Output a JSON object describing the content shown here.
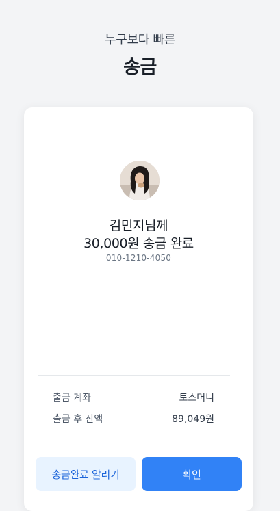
{
  "header": {
    "subtitle": "누구보다 빠른",
    "title": "송금"
  },
  "transfer": {
    "recipient": "김민지님께",
    "amount_message": "30,000원 송금 완료",
    "phone": "010-1210-4050"
  },
  "details": [
    {
      "label": "출금 계좌",
      "value": "토스머니"
    },
    {
      "label": "출금 후 잔액",
      "value": "89,049원"
    }
  ],
  "buttons": {
    "notify": "송금완료 알리기",
    "confirm": "확인"
  },
  "colors": {
    "primary": "#3182f6",
    "secondary_bg": "#e8f3ff",
    "secondary_text": "#1b64da",
    "page_bg": "#f3f4f6"
  }
}
